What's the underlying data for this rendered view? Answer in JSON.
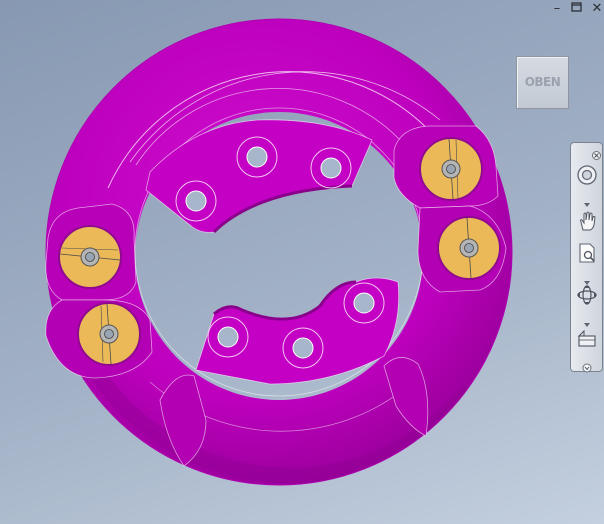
{
  "window": {
    "minimize_icon": "minimize-icon",
    "restore_icon": "restore-icon",
    "close_icon": "close-icon"
  },
  "viewcube": {
    "face_label": "OBEN"
  },
  "navigation_bar": {
    "tools": [
      "steering-wheel-icon",
      "pan-icon",
      "zoom-window-icon",
      "orbit-icon",
      "view-face-icon"
    ]
  },
  "colors": {
    "part": "#c800c8",
    "part_dark": "#9e00a0",
    "highlight": "#ebb957",
    "viewport_top": "#8798b2",
    "viewport_bottom": "#c4d0df"
  }
}
